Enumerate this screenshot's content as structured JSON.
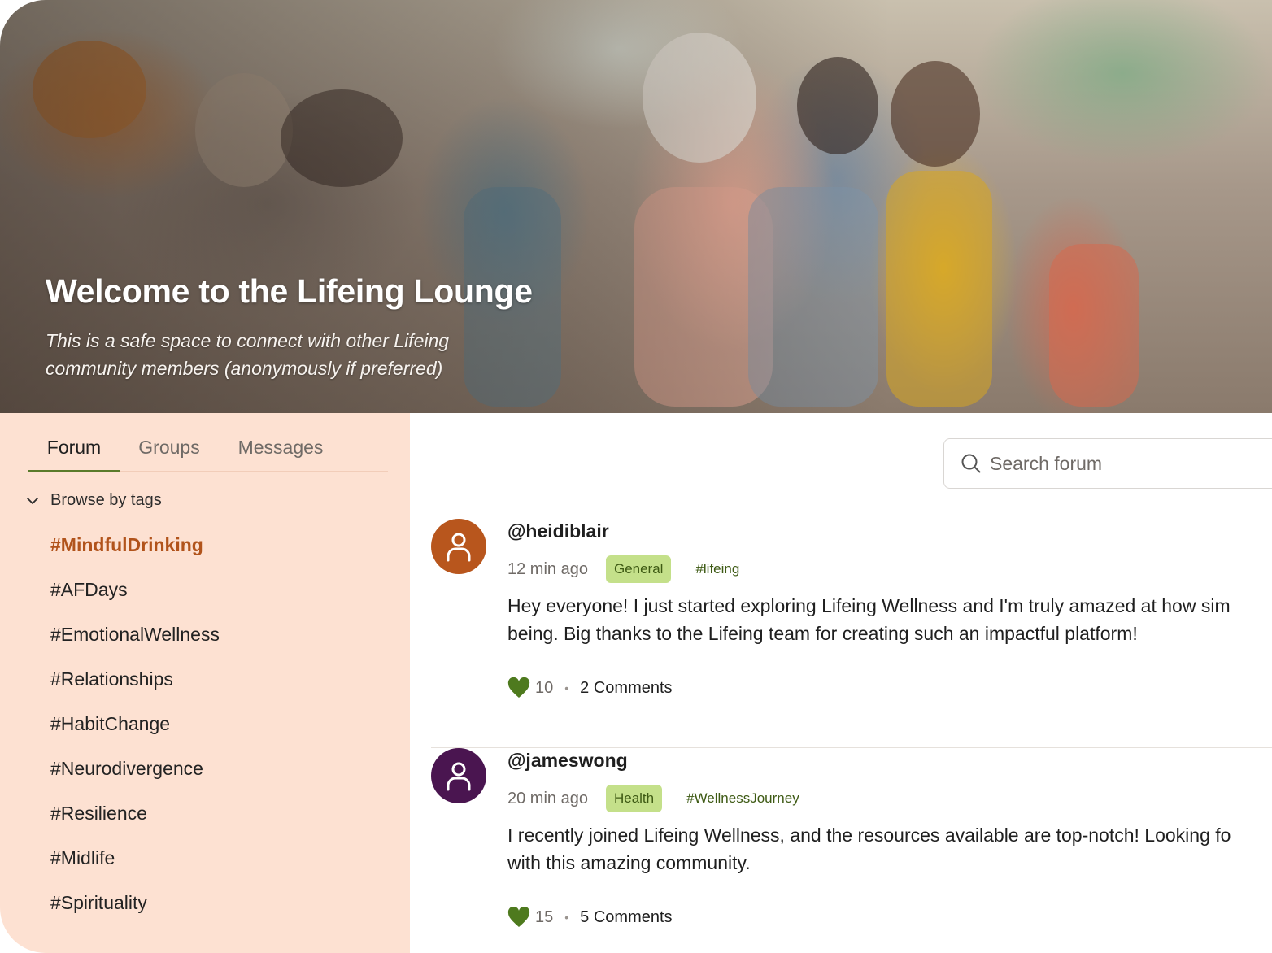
{
  "hero": {
    "title": "Welcome to the Lifeing Lounge",
    "subtitle": "This is a safe space to connect with other Lifeing community members (anonymously if preferred)"
  },
  "tabs": [
    {
      "label": "Forum",
      "active": true
    },
    {
      "label": "Groups",
      "active": false
    },
    {
      "label": "Messages",
      "active": false
    }
  ],
  "sidebar": {
    "browse_label": "Browse by tags",
    "tags": [
      {
        "label": "#MindfulDrinking",
        "active": true
      },
      {
        "label": "#AFDays"
      },
      {
        "label": "#EmotionalWellness"
      },
      {
        "label": "#Relationships"
      },
      {
        "label": "#HabitChange"
      },
      {
        "label": "#Neurodivergence"
      },
      {
        "label": "#Resilience"
      },
      {
        "label": "#Midlife"
      },
      {
        "label": "#Spirituality"
      }
    ]
  },
  "search": {
    "placeholder": "Search forum"
  },
  "posts": [
    {
      "username": "@heidiblair",
      "time": "12 min ago",
      "category": "General",
      "hashtag": "#lifeing",
      "lines": [
        "Hey everyone! I just started exploring Lifeing Wellness and I'm truly amazed at how sim",
        "being. Big thanks to the Lifeing team for creating such an impactful platform!"
      ],
      "likes": "10",
      "comments": "2 Comments",
      "avatar_color": "#b8561d"
    },
    {
      "username": "@jameswong",
      "time": "20 min ago",
      "category": "Health",
      "hashtag": "#WellnessJourney",
      "lines": [
        "I recently joined Lifeing Wellness, and the resources available are top-notch! Looking fo",
        "with this amazing community."
      ],
      "likes": "15",
      "comments": "5 Comments",
      "avatar_color": "#4a1550"
    }
  ],
  "colors": {
    "accent_green": "#5a7a2a",
    "tag_active": "#b1531b",
    "sidebar_bg": "#fde1d2",
    "heart": "#4e7a1e",
    "category_bg": "#c4e08a"
  },
  "icons": {
    "chevron": "chevron-down-icon",
    "search": "search-icon",
    "avatar": "user-icon",
    "like": "heart-icon"
  }
}
